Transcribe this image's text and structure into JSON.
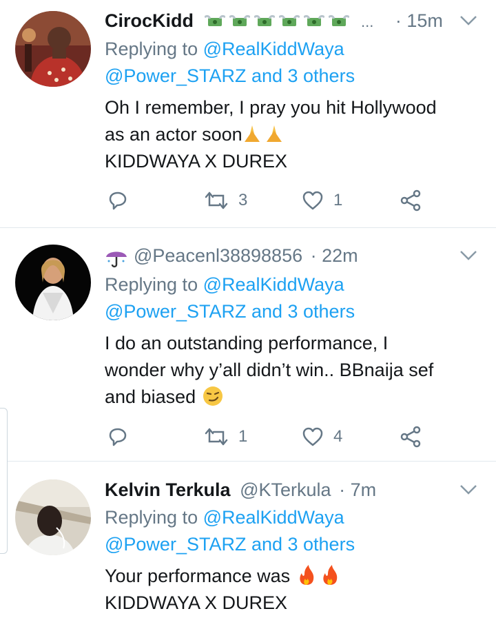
{
  "tweets": [
    {
      "display_name": "CirocKidd",
      "name_suffix": "...",
      "handle": "",
      "time": "· 15m",
      "replying_label": "Replying to",
      "replying_to_1": "@RealKiddWaya",
      "replying_to_2": "@Power_STARZ and 3 others",
      "lines": [
        "Oh I remember, I pray you hit Hollywood",
        "as an actor soon",
        "KIDDWAYA X DUREX"
      ],
      "retweets": "3",
      "likes": "1",
      "avatar_colors": [
        "#a63a2e",
        "#f0d9c4"
      ]
    },
    {
      "display_name": "",
      "handle": "@Peacenl38898856",
      "time": "· 22m",
      "replying_label": "Replying to",
      "replying_to_1": "@RealKiddWaya",
      "replying_to_2": "@Power_STARZ and 3 others",
      "lines": [
        "I do an outstanding performance, I",
        "wonder why y’all didn’t win.. BBnaija sef",
        "and biased"
      ],
      "retweets": "1",
      "likes": "4",
      "avatar_colors": [
        "#0a0a0a",
        "#f2f2f2"
      ]
    },
    {
      "display_name": "Kelvin Terkula",
      "handle": "@KTerkula",
      "time": "· 7m",
      "replying_label": "Replying to",
      "replying_to_1": "@RealKiddWaya",
      "replying_to_2": "@Power_STARZ and 3 others",
      "lines": [
        "Your performance was",
        "KIDDWAYA X DUREX"
      ],
      "avatar_colors": [
        "#c9c2b6",
        "#2a2320"
      ]
    }
  ],
  "colors": {
    "link": "#1da1f2",
    "meta": "#657786",
    "text": "#14171a",
    "divider": "#e1e8ed"
  }
}
